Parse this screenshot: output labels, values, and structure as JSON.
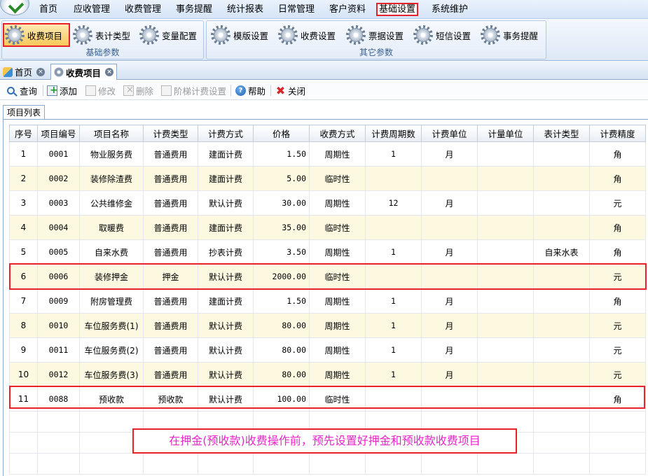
{
  "menu": {
    "items": [
      "首页",
      "应收管理",
      "收费管理",
      "事务提醒",
      "统计报表",
      "日常管理",
      "客户资料",
      "基础设置",
      "系统维护"
    ],
    "active": "基础设置"
  },
  "ribbon": {
    "group1": {
      "label": "基础参数",
      "buttons": [
        "收费项目",
        "表计类型",
        "变量配置"
      ]
    },
    "group2": {
      "label": "其它参数",
      "buttons": [
        "模版设置",
        "收费设置",
        "票据设置",
        "短信设置",
        "事务提醒"
      ]
    }
  },
  "tabs": [
    {
      "label": "首页",
      "icon": "home-icon"
    },
    {
      "label": "收费项目",
      "icon": "gear-icon"
    }
  ],
  "toolbar": {
    "query": "查询",
    "add": "添加",
    "edit": "修改",
    "delete": "删除",
    "tier": "阶梯计费设置",
    "help": "帮助",
    "close": "关闭"
  },
  "list_tab": "项目列表",
  "grid": {
    "columns": [
      "序号",
      "项目编号",
      "项目名称",
      "计费类型",
      "计费方式",
      "价格",
      "收费方式",
      "计费周期数",
      "计费单位",
      "计量单位",
      "表计类型",
      "计费精度"
    ],
    "rows": [
      [
        "1",
        "0001",
        "物业服务费",
        "普通费用",
        "建面计费",
        "1.50",
        "周期性",
        "1",
        "月",
        "",
        "",
        "角"
      ],
      [
        "2",
        "0002",
        "装修除渣费",
        "普通费用",
        "建面计费",
        "5.00",
        "临时性",
        "",
        "",
        "",
        "",
        "角"
      ],
      [
        "3",
        "0003",
        "公共维修金",
        "普通费用",
        "默认计费",
        "30.00",
        "周期性",
        "12",
        "月",
        "",
        "",
        "元"
      ],
      [
        "4",
        "0004",
        "取暖费",
        "普通费用",
        "建面计费",
        "35.00",
        "临时性",
        "",
        "",
        "",
        "",
        "角"
      ],
      [
        "5",
        "0005",
        "自来水费",
        "普通费用",
        "抄表计费",
        "3.50",
        "周期性",
        "1",
        "月",
        "",
        "自来水表",
        "角"
      ],
      [
        "6",
        "0006",
        "装修押金",
        "押金",
        "默认计费",
        "2000.00",
        "临时性",
        "",
        "",
        "",
        "",
        "元"
      ],
      [
        "7",
        "0009",
        "附房管理费",
        "普通费用",
        "建面计费",
        "1.50",
        "周期性",
        "1",
        "月",
        "",
        "",
        "角"
      ],
      [
        "8",
        "0010",
        "车位服务费(1)",
        "普通费用",
        "默认计费",
        "80.00",
        "周期性",
        "1",
        "月",
        "",
        "",
        "元"
      ],
      [
        "9",
        "0011",
        "车位服务费(2)",
        "普通费用",
        "默认计费",
        "80.00",
        "周期性",
        "1",
        "月",
        "",
        "",
        "元"
      ],
      [
        "10",
        "0012",
        "车位服务费(3)",
        "普通费用",
        "默认计费",
        "80.00",
        "周期性",
        "1",
        "月",
        "",
        "",
        "元"
      ],
      [
        "11",
        "0088",
        "预收款",
        "预收款",
        "默认计费",
        "100.00",
        "临时性",
        "",
        "",
        "",
        "",
        "角"
      ]
    ]
  },
  "callout": "在押金(预收款)收费操作前，预先设置好押金和预收款收费项目",
  "colors": {
    "highlight": "#e8222a",
    "callout_text": "#ea23c8",
    "alt_row": "#fdf9e1"
  }
}
